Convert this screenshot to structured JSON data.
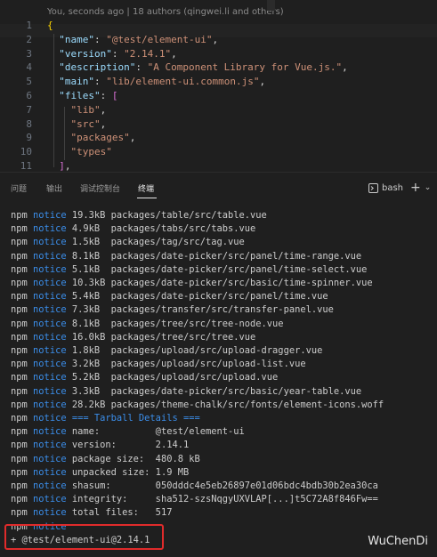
{
  "editor": {
    "blame": "You, seconds ago | 18 authors (qingwei.li and others)",
    "lines": [
      {
        "num": "1",
        "tokens": [
          {
            "t": "{",
            "c": "b1"
          }
        ]
      },
      {
        "num": "2",
        "tokens": [
          {
            "t": "  ",
            "c": "p"
          },
          {
            "t": "\"name\"",
            "c": "k"
          },
          {
            "t": ": ",
            "c": "p"
          },
          {
            "t": "\"@test/element-ui\"",
            "c": "s"
          },
          {
            "t": ",",
            "c": "p"
          }
        ]
      },
      {
        "num": "3",
        "tokens": [
          {
            "t": "  ",
            "c": "p"
          },
          {
            "t": "\"version\"",
            "c": "k"
          },
          {
            "t": ": ",
            "c": "p"
          },
          {
            "t": "\"2.14.1\"",
            "c": "s"
          },
          {
            "t": ",",
            "c": "p"
          }
        ]
      },
      {
        "num": "4",
        "tokens": [
          {
            "t": "  ",
            "c": "p"
          },
          {
            "t": "\"description\"",
            "c": "k"
          },
          {
            "t": ": ",
            "c": "p"
          },
          {
            "t": "\"A Component Library for Vue.js.\"",
            "c": "s"
          },
          {
            "t": ",",
            "c": "p"
          }
        ]
      },
      {
        "num": "5",
        "tokens": [
          {
            "t": "  ",
            "c": "p"
          },
          {
            "t": "\"main\"",
            "c": "k"
          },
          {
            "t": ": ",
            "c": "p"
          },
          {
            "t": "\"lib/element-ui.common.js\"",
            "c": "s"
          },
          {
            "t": ",",
            "c": "p"
          }
        ]
      },
      {
        "num": "6",
        "tokens": [
          {
            "t": "  ",
            "c": "p"
          },
          {
            "t": "\"files\"",
            "c": "k"
          },
          {
            "t": ": ",
            "c": "p"
          },
          {
            "t": "[",
            "c": "b2"
          }
        ]
      },
      {
        "num": "7",
        "tokens": [
          {
            "t": "    ",
            "c": "p"
          },
          {
            "t": "\"lib\"",
            "c": "s"
          },
          {
            "t": ",",
            "c": "p"
          }
        ]
      },
      {
        "num": "8",
        "tokens": [
          {
            "t": "    ",
            "c": "p"
          },
          {
            "t": "\"src\"",
            "c": "s"
          },
          {
            "t": ",",
            "c": "p"
          }
        ]
      },
      {
        "num": "9",
        "tokens": [
          {
            "t": "    ",
            "c": "p"
          },
          {
            "t": "\"packages\"",
            "c": "s"
          },
          {
            "t": ",",
            "c": "p"
          }
        ]
      },
      {
        "num": "10",
        "tokens": [
          {
            "t": "    ",
            "c": "p"
          },
          {
            "t": "\"types\"",
            "c": "s"
          }
        ]
      },
      {
        "num": "11",
        "tokens": [
          {
            "t": "  ",
            "c": "p"
          },
          {
            "t": "]",
            "c": "b2"
          },
          {
            "t": ",",
            "c": "p"
          }
        ]
      }
    ]
  },
  "panel": {
    "tabs": [
      "问题",
      "输出",
      "调试控制台",
      "终端"
    ],
    "active_tab": "终端",
    "shell": "bash",
    "add_label": "+",
    "chevron": "⌄"
  },
  "terminal": {
    "lines": [
      {
        "prefix": "npm",
        "level": "notice",
        "rest": " 19.3kB packages/table/src/table.vue"
      },
      {
        "prefix": "npm",
        "level": "notice",
        "rest": " 4.9kB  packages/tabs/src/tabs.vue"
      },
      {
        "prefix": "npm",
        "level": "notice",
        "rest": " 1.5kB  packages/tag/src/tag.vue"
      },
      {
        "prefix": "npm",
        "level": "notice",
        "rest": " 8.1kB  packages/date-picker/src/panel/time-range.vue"
      },
      {
        "prefix": "npm",
        "level": "notice",
        "rest": " 5.1kB  packages/date-picker/src/panel/time-select.vue"
      },
      {
        "prefix": "npm",
        "level": "notice",
        "rest": " 10.3kB packages/date-picker/src/basic/time-spinner.vue"
      },
      {
        "prefix": "npm",
        "level": "notice",
        "rest": " 5.4kB  packages/date-picker/src/panel/time.vue"
      },
      {
        "prefix": "npm",
        "level": "notice",
        "rest": " 7.3kB  packages/transfer/src/transfer-panel.vue"
      },
      {
        "prefix": "npm",
        "level": "notice",
        "rest": " 8.1kB  packages/tree/src/tree-node.vue"
      },
      {
        "prefix": "npm",
        "level": "notice",
        "rest": " 16.0kB packages/tree/src/tree.vue"
      },
      {
        "prefix": "npm",
        "level": "notice",
        "rest": " 1.8kB  packages/upload/src/upload-dragger.vue"
      },
      {
        "prefix": "npm",
        "level": "notice",
        "rest": " 3.2kB  packages/upload/src/upload-list.vue"
      },
      {
        "prefix": "npm",
        "level": "notice",
        "rest": " 5.2kB  packages/upload/src/upload.vue"
      },
      {
        "prefix": "npm",
        "level": "notice",
        "rest": " 3.3kB  packages/date-picker/src/basic/year-table.vue"
      },
      {
        "prefix": "npm",
        "level": "notice",
        "rest": " 28.2kB packages/theme-chalk/src/fonts/element-icons.woff"
      },
      {
        "prefix": "npm",
        "level": "notice",
        "rest": " === Tarball Details ===",
        "header": true
      },
      {
        "prefix": "npm",
        "level": "notice",
        "rest": " name:          @test/element-ui"
      },
      {
        "prefix": "npm",
        "level": "notice",
        "rest": " version:       2.14.1"
      },
      {
        "prefix": "npm",
        "level": "notice",
        "rest": " package size:  480.8 kB"
      },
      {
        "prefix": "npm",
        "level": "notice",
        "rest": " unpacked size: 1.9 MB"
      },
      {
        "prefix": "npm",
        "level": "notice",
        "rest": " shasum:        050dddc4e5eb26897e01d06bdc4bdb30b2ea30ca"
      },
      {
        "prefix": "npm",
        "level": "notice",
        "rest": " integrity:     sha512-szsNqgyUXVLAP[...]t5C72A8f846Fw=="
      },
      {
        "prefix": "npm",
        "level": "notice",
        "rest": " total files:   517"
      },
      {
        "prefix": "npm",
        "level": "notice",
        "rest": ""
      },
      {
        "prefix": "+",
        "level": "",
        "rest": " @test/element-ui@2.14.1"
      }
    ]
  },
  "watermark": "WuChenDi",
  "colors": {
    "background": "#1f1f1f",
    "notice": "#3b8eea",
    "highlight_box": "#e02b2b"
  }
}
